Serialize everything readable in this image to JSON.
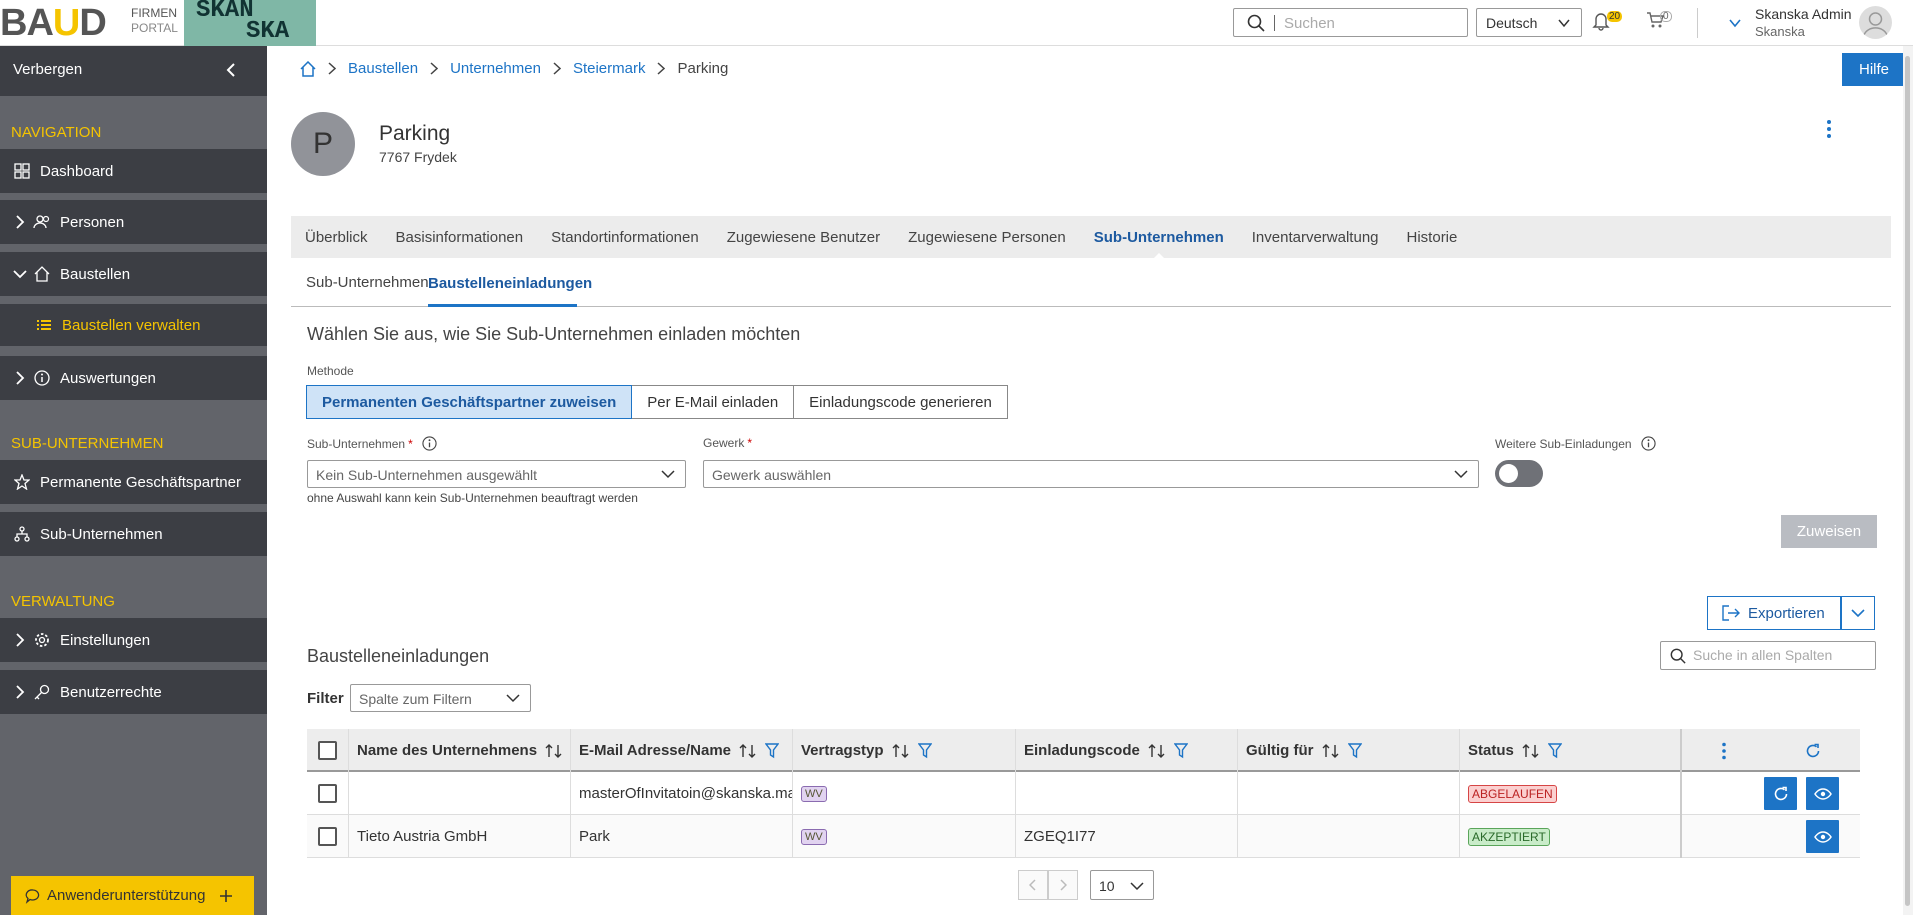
{
  "header": {
    "logo_text_main": "BA",
    "logo_text_accent": "U",
    "logo_text_end": "D",
    "logo_firmen": "FIRMEN",
    "logo_portal": "PORTAL",
    "brand_line1": "SKAN",
    "brand_line2": "SKA",
    "search_placeholder": "Suchen",
    "language": "Deutsch",
    "notifications_count": "20",
    "cart_count": "0",
    "user_name": "Skanska Admin",
    "user_org": "Skanska"
  },
  "sidebar": {
    "hide_label": "Verbergen",
    "section_navigation": "NAVIGATION",
    "nav": [
      {
        "label": "Dashboard"
      },
      {
        "label": "Personen"
      },
      {
        "label": "Baustellen"
      },
      {
        "label": "Baustellen verwalten"
      },
      {
        "label": "Auswertungen"
      }
    ],
    "section_sub": "SUB-UNTERNEHMEN",
    "sub": [
      {
        "label": "Permanente Geschäftspartner"
      },
      {
        "label": "Sub-Unternehmen"
      }
    ],
    "section_admin": "VERWALTUNG",
    "admin": [
      {
        "label": "Einstellungen"
      },
      {
        "label": "Benutzerrechte"
      }
    ],
    "support_label": "Anwenderunterstützung"
  },
  "help_label": "Hilfe",
  "breadcrumb": [
    "Baustellen",
    "Unternehmen",
    "Steiermark",
    "Parking"
  ],
  "site": {
    "initial": "P",
    "name": "Parking",
    "address": "7767 Frydek"
  },
  "tabs": [
    "Überblick",
    "Basisinformationen",
    "Standortinformationen",
    "Zugewiesene Benutzer",
    "Zugewiesene Personen",
    "Sub-Unternehmen",
    "Inventarverwaltung",
    "Historie"
  ],
  "subtabs": [
    "Sub-Unternehmen",
    "Baustelleneinladungen"
  ],
  "invite": {
    "title": "Wählen Sie aus, wie Sie Sub-Unternehmen einladen möchten",
    "method_label": "Methode",
    "methods": [
      "Permanenten Geschäftspartner zuweisen",
      "Per E-Mail einladen",
      "Einladungscode generieren"
    ],
    "sub_label": "Sub-Unternehmen",
    "sub_placeholder": "Kein Sub-Unternehmen ausgewählt",
    "sub_hint": "ohne Auswahl kann kein Sub-Unternehmen beauftragt werden",
    "gewerk_label": "Gewerk",
    "gewerk_placeholder": "Gewerk auswählen",
    "further_label": "Weitere Sub-Einladungen",
    "assign_label": "Zuweisen"
  },
  "export_label": "Exportieren",
  "table": {
    "title": "Baustelleneinladungen",
    "search_placeholder": "Suche in allen Spalten",
    "filter_label": "Filter",
    "filter_placeholder": "Spalte zum Filtern",
    "columns": [
      "Name des Unternehmens",
      "E-Mail Adresse/Name",
      "Vertragstyp",
      "Einladungscode",
      "Gültig für",
      "Status"
    ],
    "rows": [
      {
        "name": "",
        "email": "masterOfInvitatoin@skanska.ma",
        "type": "WV",
        "code": "",
        "valid": "",
        "status": "ABGELAUFEN"
      },
      {
        "name": "Tieto Austria GmbH",
        "email": "Park",
        "type": "WV",
        "code": "ZGEQ1I77",
        "valid": "",
        "status": "AKZEPTIERT"
      }
    ],
    "page_size": "10"
  },
  "colors": {
    "accent": "#1d74c6",
    "brand_yellow": "#f5c400",
    "sidebar": "#3c3e44"
  }
}
